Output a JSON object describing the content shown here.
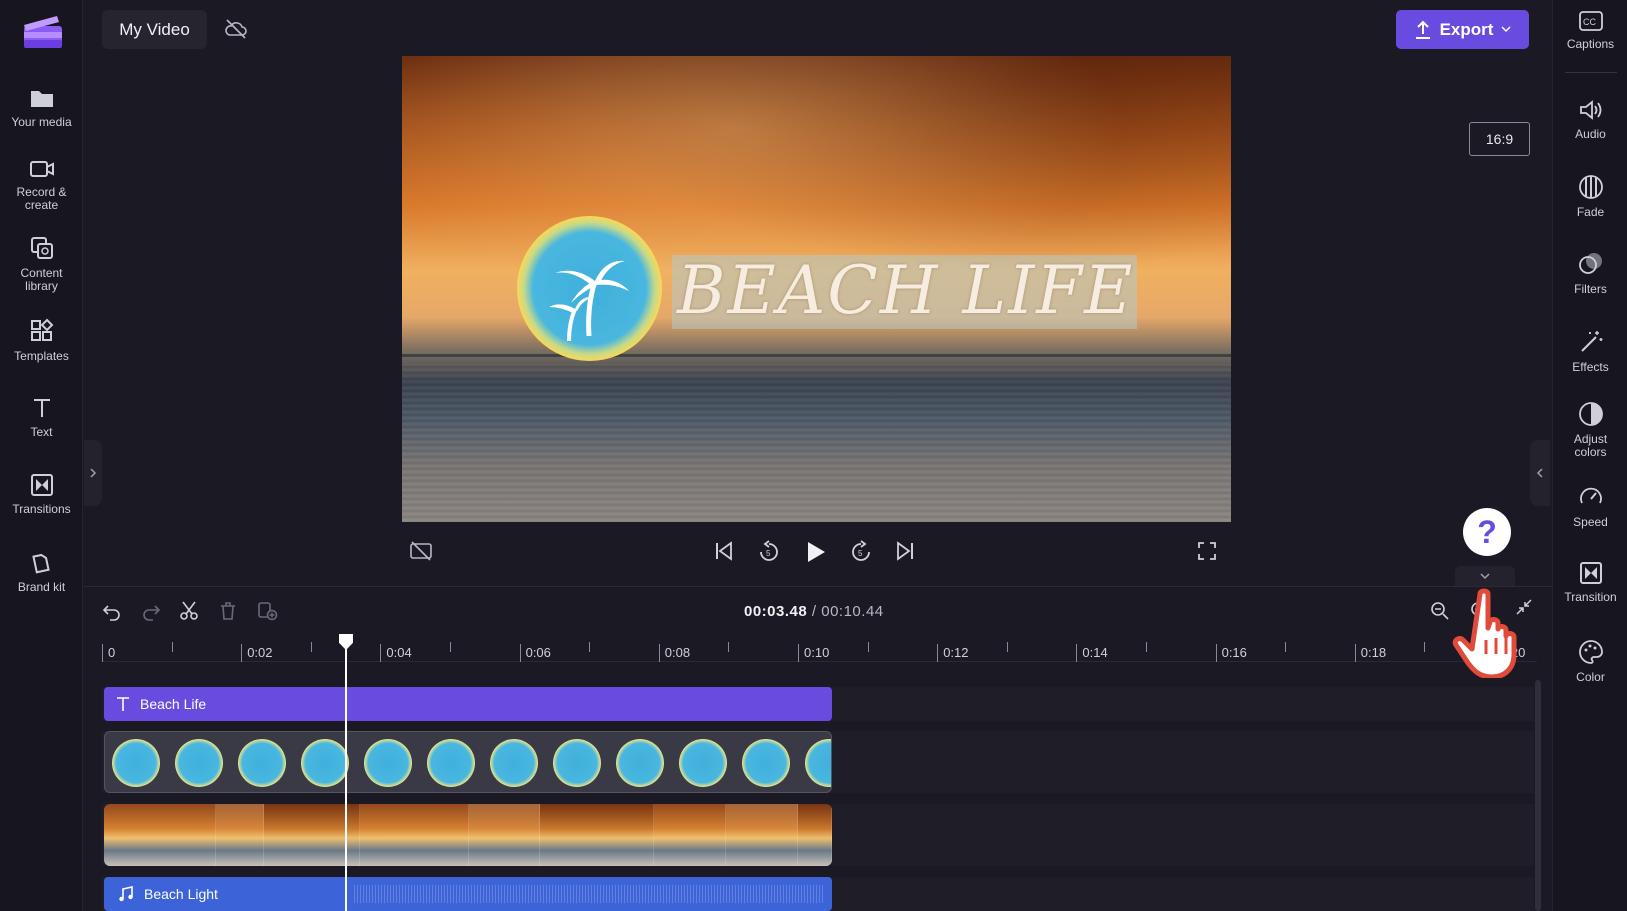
{
  "app": {
    "project_title": "My Video",
    "export_label": "Export",
    "aspect_ratio": "16:9",
    "accent_color": "#6a4be0",
    "audio_clip_color": "#3c63d8"
  },
  "left_nav": [
    {
      "label": "Your media",
      "icon": "folder-icon"
    },
    {
      "label": "Record & create",
      "icon": "video-camera-icon"
    },
    {
      "label": "Content library",
      "icon": "content-library-icon"
    },
    {
      "label": "Templates",
      "icon": "templates-icon"
    },
    {
      "label": "Text",
      "icon": "text-icon"
    },
    {
      "label": "Transitions",
      "icon": "transitions-icon"
    },
    {
      "label": "Brand kit",
      "icon": "brand-kit-icon"
    }
  ],
  "right_nav": [
    {
      "label": "Captions",
      "icon": "captions-icon"
    },
    {
      "label": "Audio",
      "icon": "speaker-icon"
    },
    {
      "label": "Fade",
      "icon": "fade-icon"
    },
    {
      "label": "Filters",
      "icon": "filters-icon"
    },
    {
      "label": "Effects",
      "icon": "magic-wand-icon"
    },
    {
      "label": "Adjust colors",
      "icon": "adjust-colors-icon"
    },
    {
      "label": "Speed",
      "icon": "speedometer-icon"
    },
    {
      "label": "Transition",
      "icon": "transition-icon"
    },
    {
      "label": "Color",
      "icon": "palette-icon"
    }
  ],
  "preview": {
    "overlay_text": "BEACH LIFE"
  },
  "help_label": "?",
  "timeline": {
    "current_time": "00:03.48",
    "separator": " / ",
    "total_time": "00:10.44",
    "ruler_labels": [
      "0",
      "0:02",
      "0:04",
      "0:06",
      "0:08",
      "0:10",
      "0:12",
      "0:14",
      "0:16",
      "0:18",
      "0:20"
    ],
    "tracks": {
      "text_clip": "Beach Life",
      "audio_clip": "Beach Light"
    }
  }
}
